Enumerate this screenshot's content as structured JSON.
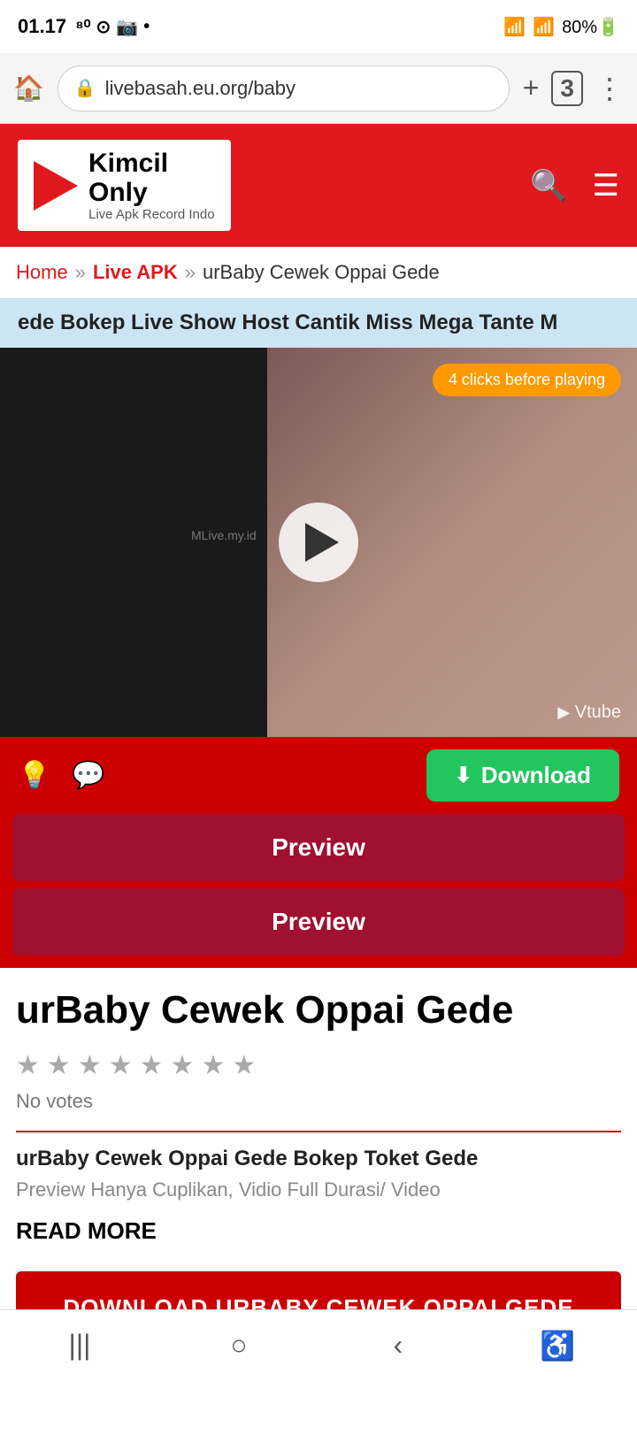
{
  "status_bar": {
    "time": "01.17",
    "battery": "80%"
  },
  "browser": {
    "url": "livebasah.eu.org/baby",
    "tab_count": "3"
  },
  "site_header": {
    "logo_line1": "Kimcil",
    "logo_line2": "Only",
    "logo_sub": "Live Apk Record Indo"
  },
  "breadcrumb": {
    "home": "Home",
    "separator1": "»",
    "live_apk": "Live APK",
    "separator2": "»",
    "current": "urBaby Cewek Oppai Gede"
  },
  "banner": {
    "text": "ede Bokep Live Show Host Cantik Miss Mega Tante M"
  },
  "video": {
    "clicks_notice": "4 clicks before playing",
    "watermark": "Vtube",
    "mlive_watermark": "MLive.my.id"
  },
  "controls": {
    "download_label": "Download"
  },
  "preview_buttons": {
    "btn1": "Preview",
    "btn2": "Preview"
  },
  "page_title": "urBaby Cewek Oppai Gede",
  "rating": {
    "no_votes": "No votes",
    "stars": [
      "★",
      "★",
      "★",
      "★",
      "★",
      "★",
      "★",
      "★"
    ]
  },
  "article": {
    "title": "urBaby Cewek Oppai Gede Bokep Toket Gede",
    "preview": "Preview Hanya Cuplikan, Vidio Full Durasi/ Video",
    "read_more": "READ MORE"
  },
  "bottom_button": {
    "label": "DOWNLOAD URBABY CEWEK OPPAI GEDE"
  },
  "nav": {
    "back": "‹",
    "home_circle": "○",
    "menu": "|||",
    "accessibility": "♿"
  }
}
